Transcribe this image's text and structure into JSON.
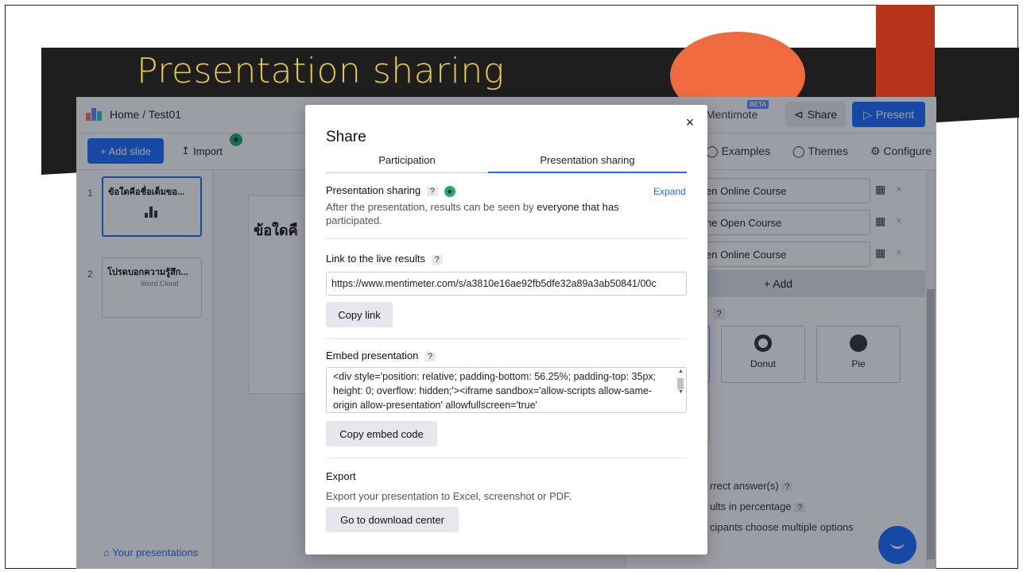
{
  "slide": {
    "title": "Presentation sharing"
  },
  "app": {
    "breadcrumb": "Home / Test01",
    "mentimote_label": "Mentimote",
    "beta_badge": "BETA",
    "share_label": "Share",
    "present_label": "Present",
    "add_slide_label": "+ Add slide",
    "import_label": "Import",
    "tool_links": [
      "Examples",
      "Themes",
      "Configure"
    ],
    "slides": [
      {
        "number": "1",
        "title": "ข้อใดคือชื่อเต็มขอ..."
      },
      {
        "number": "2",
        "title": "โปรดบอกความรู้สึก..."
      }
    ],
    "thumb2_word": "Word Cloud",
    "your_presentations_label": "Your presentations",
    "canvas_text": "ข้อใดคื",
    "options": [
      "en Online Course",
      "ne Open Course",
      "en Online Course"
    ],
    "add_option_label": "+ Add",
    "type_tiles": [
      "Donut",
      "Pie"
    ],
    "type_question_badge": "?",
    "settings": [
      "rrect answer(s)",
      "ults in percentage",
      "cipants choose multiple options"
    ],
    "icons": {
      "image_icon": "image-icon",
      "remove_icon": "close-icon"
    }
  },
  "modal": {
    "close_glyph": "×",
    "title": "Share",
    "tabs": [
      "Participation",
      "Presentation sharing"
    ],
    "active_tab": "Presentation sharing",
    "presentation_sharing": {
      "heading": "Presentation sharing",
      "help_badge": "?",
      "expand_label": "Expand",
      "description_before": "After the presentation, results can be seen by ",
      "description_bold": "everyone that has",
      "description_after": "participated."
    },
    "live_results": {
      "heading": "Link to the live results",
      "help_badge": "?",
      "url": "https://www.mentimeter.com/s/a3810e16ae92fb5dfe32a89a3ab50841/00c",
      "copy_label": "Copy link"
    },
    "embed": {
      "heading": "Embed presentation",
      "help_badge": "?",
      "code": "<div style='position: relative; padding-bottom: 56.25%; padding-top: 35px; height: 0; overflow: hidden;'><iframe sandbox='allow-scripts allow-same-origin allow-presentation' allowfullscreen='true'",
      "copy_label": "Copy embed code"
    },
    "export": {
      "heading": "Export",
      "description": "Export your presentation to Excel, screenshot or PDF.",
      "button_label": "Go to download center"
    }
  },
  "colors": {
    "accent_blue": "#196cff",
    "title_yellow": "#e8c64a",
    "orange": "#f06a3f",
    "dark_red": "#b5341a",
    "green_badge": "#19b06c"
  }
}
